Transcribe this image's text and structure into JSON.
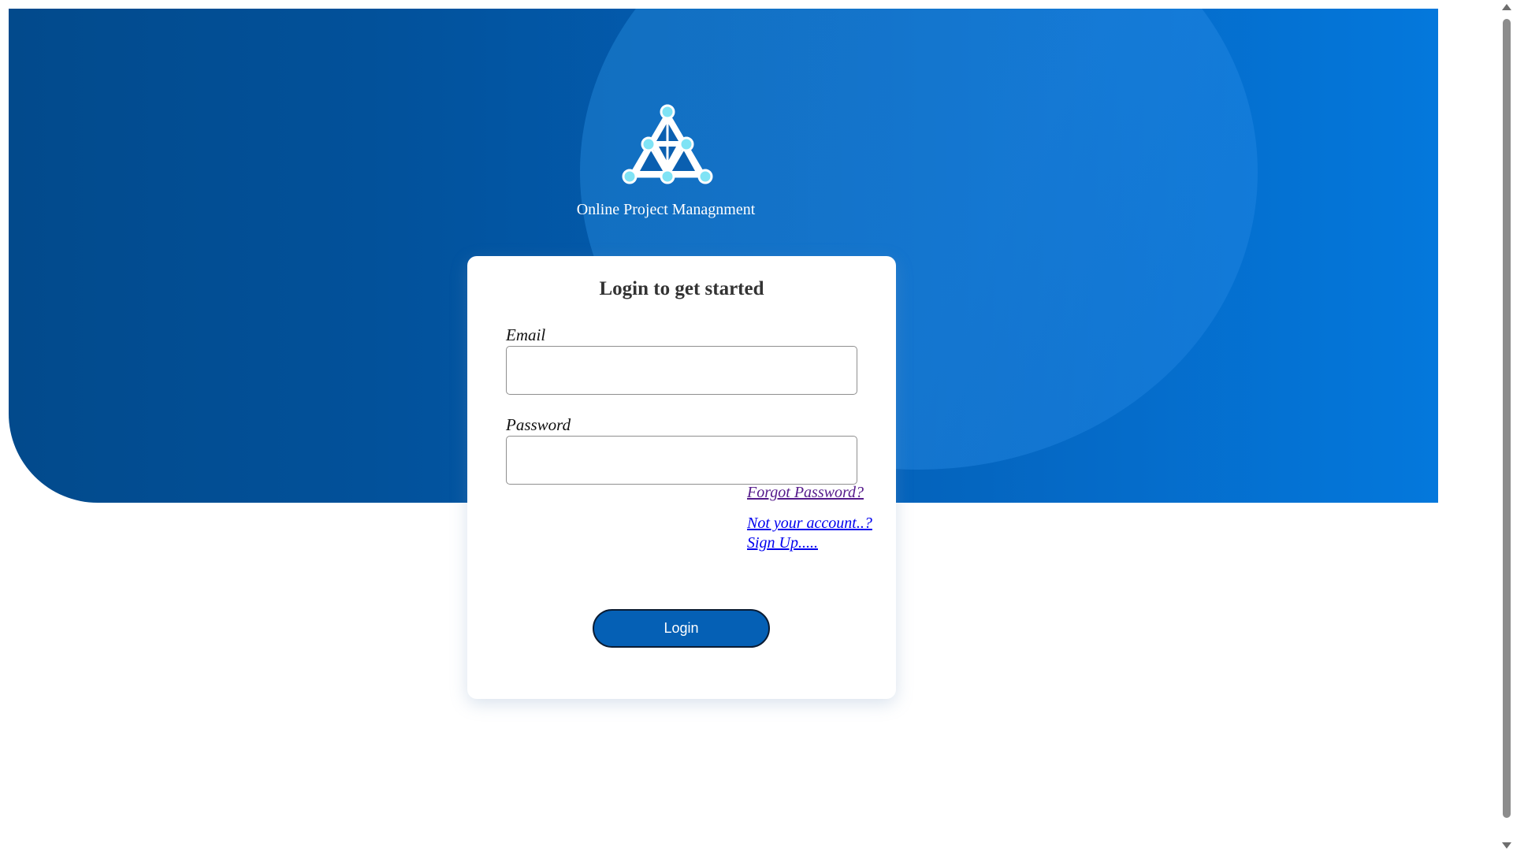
{
  "app": {
    "title": "Online Project Managnment"
  },
  "login": {
    "heading": "Login to get started",
    "email_label": "Email",
    "email_value": "",
    "password_label": "Password",
    "password_value": "",
    "forgot_link": "Forgot Password?",
    "not_account_link": "Not your account..?",
    "signup_link": "Sign Up.....",
    "submit_label": "Login"
  },
  "icons": {
    "logo": "network-triangle-logo-icon"
  },
  "colors": {
    "hero_gradient_start": "#024a8c",
    "hero_gradient_end": "#0478dc",
    "button_bg": "#0560b5",
    "visited_link": "#551a8b",
    "link": "#0000ee",
    "logo_node": "#7fe3f5"
  }
}
